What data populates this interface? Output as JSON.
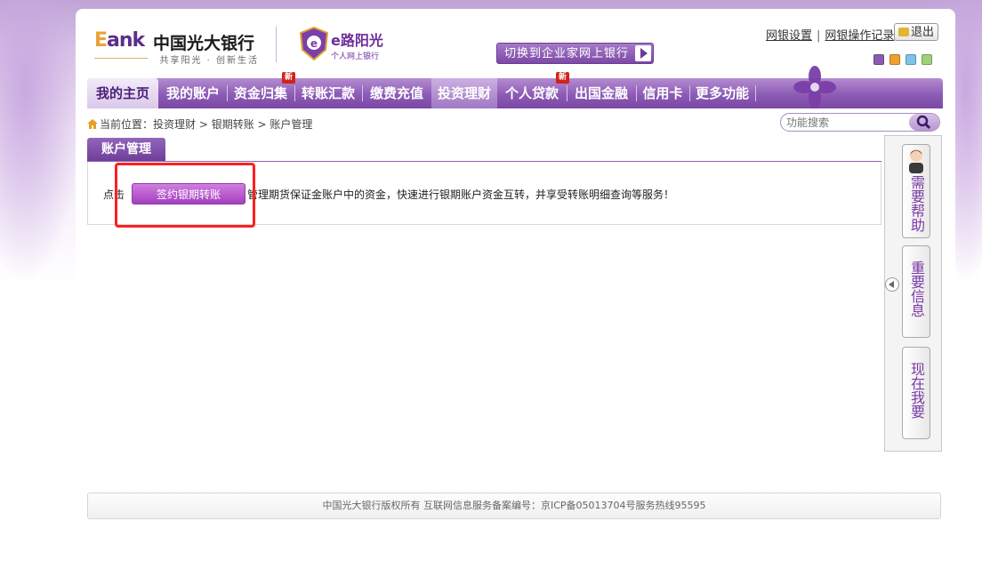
{
  "brand": {
    "logo_e": "E",
    "logo_ank": "ank",
    "bank_name": "中国光大银行",
    "slogan": "共享阳光 · 创新生活",
    "badge_title": "e路阳光",
    "badge_subtitle": "个人网上银行"
  },
  "header": {
    "switch_label": "切换到企业家网上银行",
    "link_settings": "网银设置",
    "link_records": "网银操作记录",
    "logout_label": "退出",
    "theme_colors": [
      "#8a5cb0",
      "#f0a030",
      "#7ec3e8",
      "#9ed27a"
    ]
  },
  "nav": {
    "items": [
      {
        "label": "我的主页"
      },
      {
        "label": "我的账户"
      },
      {
        "label": "资金归集",
        "badge": "新"
      },
      {
        "label": "转账汇款"
      },
      {
        "label": "缴费充值"
      },
      {
        "label": "投资理财"
      },
      {
        "label": "个人贷款",
        "badge": "新"
      },
      {
        "label": "出国金融"
      },
      {
        "label": "信用卡"
      },
      {
        "label": "更多功能"
      }
    ]
  },
  "breadcrumb": {
    "prefix": "当前位置：",
    "items": [
      "投资理财",
      "银期转账",
      "账户管理"
    ]
  },
  "search": {
    "placeholder": "功能搜索"
  },
  "panel": {
    "tab_title": "账户管理",
    "text_before": "点击",
    "button_label": "签约银期转账",
    "text_after": "管理期货保证金账户中的资金，快速进行银期账户资金互转，并享受转账明细查询等服务！"
  },
  "side": {
    "help": "需要帮助",
    "important": "重要信息",
    "want": "现在我要"
  },
  "footer": {
    "text": "中国光大银行版权所有  互联网信息服务备案编号：京ICP备05013704号服务热线95595"
  }
}
